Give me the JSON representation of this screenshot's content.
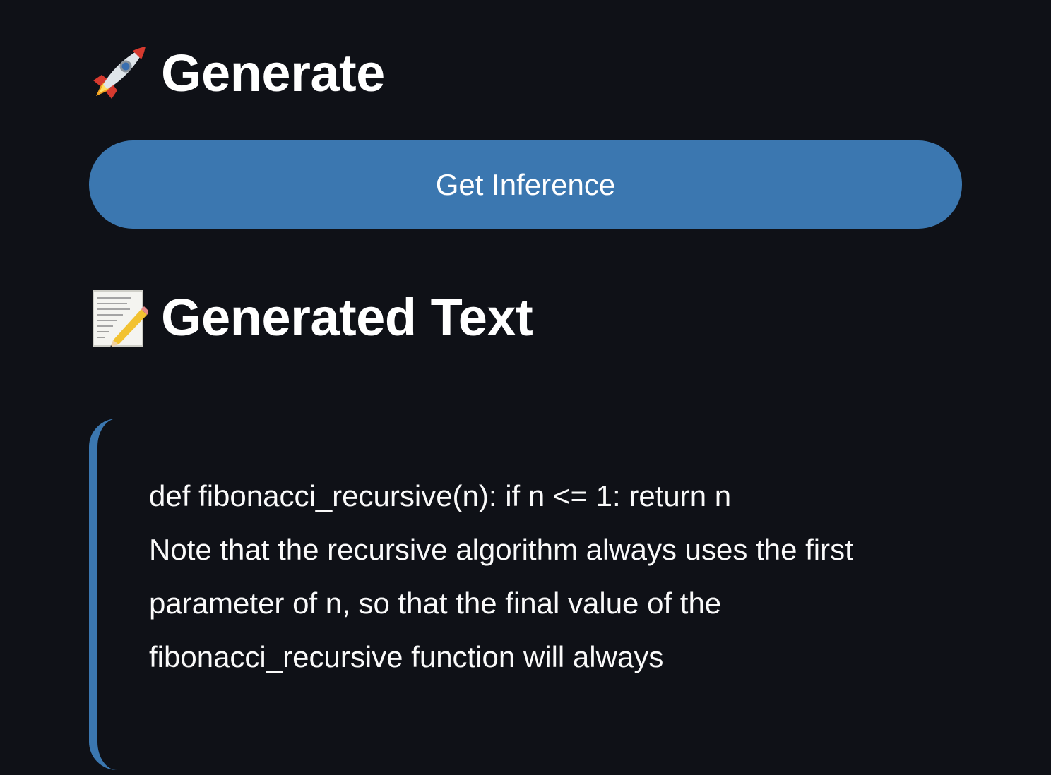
{
  "generate_section": {
    "icon": "rocket-icon",
    "title": "Generate"
  },
  "actions": {
    "get_inference_label": "Get Inference"
  },
  "output_section": {
    "icon": "memo-icon",
    "title": "Generated Text",
    "lines": [
      "def fibonacci_recursive(n): if n <= 1: return n",
      "Note that the recursive algorithm always uses the first",
      "parameter of n, so that the final value of the",
      "fibonacci_recursive function will always"
    ]
  },
  "colors": {
    "background": "#0f1117",
    "accent": "#3b77b0",
    "text": "#fafafa"
  }
}
